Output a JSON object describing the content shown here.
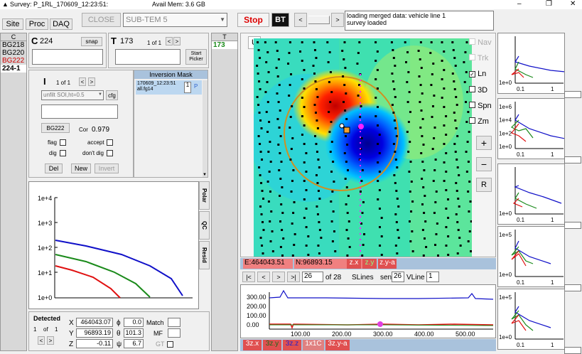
{
  "window": {
    "title": "Survey: P_1RL_170609_12:23:51:",
    "mem_label": "Avail Mem: 3.6 GB",
    "min_glyph": "–",
    "max_glyph": "❐",
    "close_glyph": "✕"
  },
  "tabs": [
    {
      "label": "Site"
    },
    {
      "label": "Proc"
    },
    {
      "label": "DAQ"
    }
  ],
  "toolbar": {
    "close_label": "CLOSE",
    "system_value": "SUB-TEM 5",
    "stop_label": "Stop",
    "bt_label": "BT",
    "prev_glyph": "<",
    "next_glyph": ">",
    "log_lines": [
      "loading merged data:  vehicle line 1",
      "survey loaded"
    ]
  },
  "c_list": {
    "header": "C",
    "items": [
      {
        "label": "BG218",
        "color": "#000000"
      },
      {
        "label": "BG220",
        "color": "#000000"
      },
      {
        "label": "BG222",
        "color": "#cc0000"
      },
      {
        "label": "224-1",
        "color": "#000000"
      }
    ]
  },
  "c_panel": {
    "label": "C",
    "value": "224",
    "snap_label": "snap"
  },
  "t_panel": {
    "label": "T",
    "value": "173",
    "page_text": "1 of 1",
    "prev": "<",
    "next": ">",
    "picker_line1": "Start",
    "picker_line2": "Picker"
  },
  "t_col": {
    "header": "T",
    "value": "173"
  },
  "i_panel": {
    "label": "I",
    "page_text": "1 of 1",
    "prev": "<",
    "next": ">",
    "filter_value": "unfilt SOI,ht=0.5",
    "cfg_label": "cfg",
    "bg_label": "BG222",
    "cor_label": "Cor",
    "cor_value": "0.979",
    "flag_label": "flag",
    "accept_label": "accept",
    "dig_label": "dig",
    "dontdig_label": "don't dig",
    "del_label": "Del",
    "new_label": "New",
    "invert_label": "Invert"
  },
  "inversion": {
    "header": "Inversion Mask",
    "item_line1": "170609_12:23:51",
    "item_line2": "all.fg14",
    "spin_value": "1",
    "tag": "P"
  },
  "side_tabs": [
    {
      "label": "Polar"
    },
    {
      "label": "QC"
    },
    {
      "label": "Resid"
    }
  ],
  "decay_plot": {
    "y_ticks": [
      "1e+4",
      "1e+3",
      "1e+2",
      "1e+1",
      "1e+0"
    ]
  },
  "detected": {
    "title": "Detected",
    "page_num": "1",
    "of_label": "of",
    "page_total": "1",
    "prev": "<",
    "next": ">",
    "x_label": "X",
    "x_value": "464043.07",
    "y_label": "Y",
    "y_value": "96893.19",
    "z_label": "Z",
    "z_value": "-0.11",
    "phi_label": "ϕ",
    "phi_value": "0.0",
    "theta_label": "θ",
    "theta_value": "101.3",
    "psi_label": "ψ",
    "psi_value": "6.7",
    "match_label": "Match",
    "mf_label": "MF",
    "gt_label": "GT"
  },
  "map": {
    "u_label": "U",
    "options": [
      {
        "label": "Nav",
        "checked": false,
        "enabled": false
      },
      {
        "label": "Trk",
        "checked": false,
        "enabled": false
      },
      {
        "label": "Ln",
        "checked": true,
        "enabled": true
      },
      {
        "label": "3D",
        "checked": false,
        "enabled": true
      },
      {
        "label": "Spn",
        "checked": false,
        "enabled": true
      },
      {
        "label": "Zm",
        "checked": false,
        "enabled": true
      }
    ],
    "zoom_in": "+",
    "zoom_out": "−",
    "reset": "R"
  },
  "coords": {
    "e_text": "E:464043.51",
    "n_text": "N:96893.15",
    "btns": [
      {
        "label": "z.x"
      },
      {
        "label": "z.y"
      },
      {
        "label": "z.y-a"
      }
    ]
  },
  "nav": {
    "first": "|<",
    "prev": "<",
    "next": ">",
    "last": ">|",
    "page_value": "26",
    "of_text": "of 28",
    "slines_label": "SLines",
    "sen_label": "sen",
    "sen_value": "26",
    "vline_label": "VLine",
    "vline_value": "1"
  },
  "profile": {
    "y_ticks": [
      "300.00",
      "200.00",
      "100.00",
      "0.00"
    ],
    "x_ticks": [
      "100.00",
      "200.00",
      "300.00",
      "400.00",
      "500.00"
    ],
    "btns": [
      {
        "label": "3z.x"
      },
      {
        "label": "3z.y"
      },
      {
        "label": "3z.z"
      },
      {
        "label": "1x1C"
      },
      {
        "label": "3z.y-a"
      }
    ]
  },
  "thumbs": [
    {
      "ticks": [
        "1e+0"
      ],
      "xt": [
        "0.1",
        "1"
      ]
    },
    {
      "ticks": [
        "1e+6",
        "1e+4",
        "1e+2",
        "1e+0"
      ],
      "xt": [
        "0.1",
        "1"
      ]
    },
    {
      "ticks": [
        "1e+0"
      ],
      "xt": [
        "0.1",
        "1"
      ]
    },
    {
      "ticks": [
        "1e+5",
        "1e+0"
      ],
      "xt": [
        "0.1",
        "1"
      ]
    },
    {
      "ticks": [
        "1e+5",
        "1e+0"
      ],
      "xt": [
        "0.1",
        "1"
      ]
    }
  ]
}
